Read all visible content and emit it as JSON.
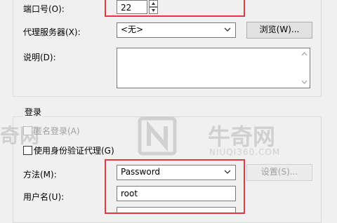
{
  "connection": {
    "port_label": "端口号(O):",
    "port_value": "22",
    "proxy_label": "代理服务器(X):",
    "proxy_selected": "<无>",
    "browse_button": "浏览(W)...",
    "desc_label": "说明(D):",
    "desc_value": ""
  },
  "login": {
    "group_title": "登录",
    "anonymous_label": "匿名登录(A)",
    "anonymous_checked": false,
    "auth_agent_label": "使用身份验证代理(G)",
    "auth_agent_checked": false,
    "method_label": "方法(M):",
    "method_selected": "Password",
    "settings_button": "设置(S)...",
    "username_label": "用户名(U):",
    "username_value": "root"
  },
  "watermark": {
    "brand_cn": "牛奇网",
    "brand_url": "NIUQI360.COM"
  },
  "colors": {
    "highlight": "#e0393e",
    "input_border": "#7a7a7a",
    "disabled_text": "#a0a0a0"
  },
  "icons": {
    "spin_up": "triangle-up-icon",
    "spin_down": "triangle-down-icon",
    "dropdown": "chevron-down-icon",
    "scroll_up": "chevron-up-icon",
    "scroll_down": "chevron-down-icon"
  }
}
